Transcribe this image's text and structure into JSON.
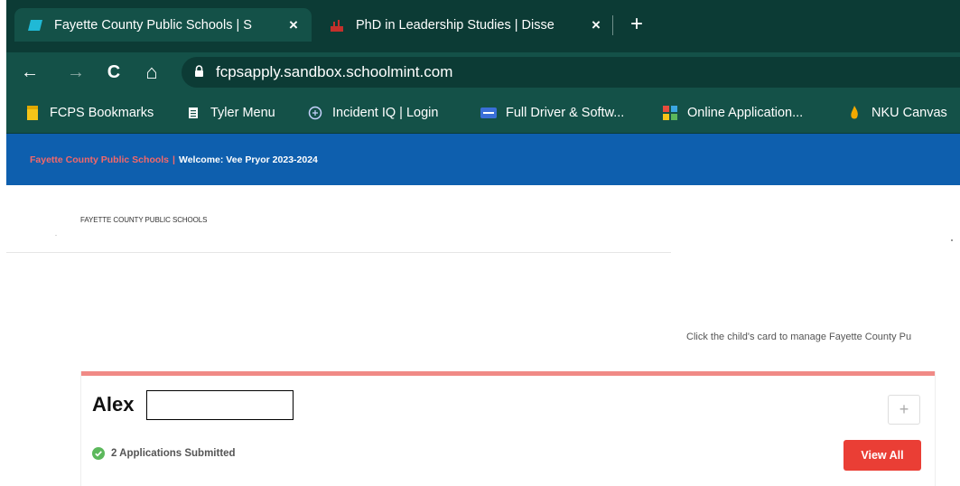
{
  "browser": {
    "tabs": [
      {
        "title": "Fayette County Public Schools | S",
        "active": true
      },
      {
        "title": "PhD in Leadership Studies | Disse",
        "active": false
      }
    ],
    "close_glyph": "×",
    "new_tab_glyph": "+",
    "back_glyph": "←",
    "forward_glyph": "→",
    "reload_glyph": "C",
    "home_glyph": "⌂",
    "url": "fcpsapply.sandbox.schoolmint.com",
    "bookmarks": [
      {
        "label": "FCPS Bookmarks",
        "icon": "folder-icon"
      },
      {
        "label": "Tyler Menu",
        "icon": "document-icon"
      },
      {
        "label": "Incident IQ | Login",
        "icon": "incident-iq-icon"
      },
      {
        "label": "Full Driver & Softw...",
        "icon": "dell-icon"
      },
      {
        "label": "Online Application...",
        "icon": "application-icon"
      },
      {
        "label": "NKU Canvas",
        "icon": "flame-icon"
      }
    ]
  },
  "site": {
    "name": "Fayette County Public Schools",
    "separator": "|",
    "welcome": "Welcome: Vee Pryor 2023-2024",
    "logo_text": "FAYETTE COUNTY PUBLIC SCHOOLS",
    "instructions": "Click the child's card to manage Fayette County Pu"
  },
  "card": {
    "child_name": "Alex",
    "add_glyph": "+",
    "status": "2 Applications Submitted",
    "view_all_label": "View All"
  },
  "colors": {
    "tab_bar": "#0c3b35",
    "toolbar": "#145148",
    "site_header": "#0e5fae",
    "site_name": "#f3686a",
    "card_accent": "#f08a86",
    "view_all": "#ea3e35",
    "success": "#5cb85c"
  }
}
